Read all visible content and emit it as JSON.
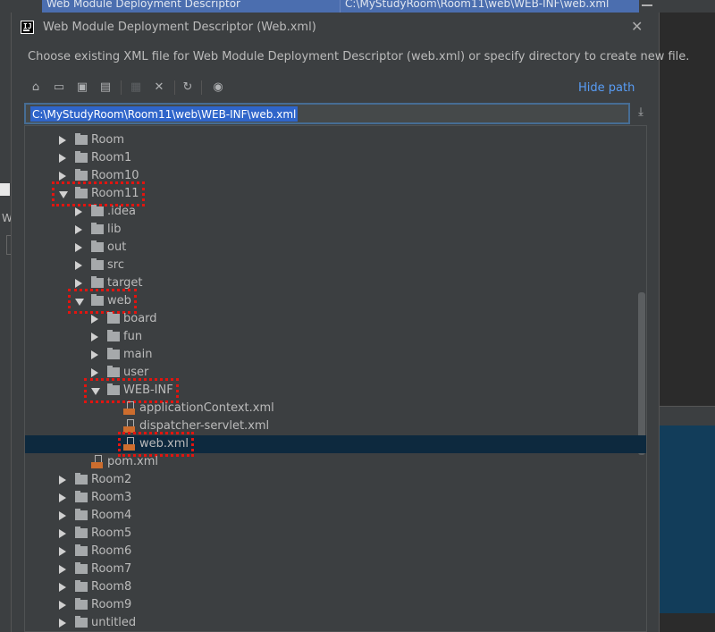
{
  "background": {
    "window_title": "Web Module Deployment Descriptor",
    "window_path": "C:\\MyStudyRoom\\Room11\\web\\WEB-INF\\web.xml",
    "left_letter": "W"
  },
  "dialog": {
    "title": "Web Module Deployment Descriptor (Web.xml)",
    "description": "Choose existing XML file for Web Module Deployment Descriptor (web.xml) or specify directory to create new file.",
    "hide_path_label": "Hide path",
    "path_value": "C:\\MyStudyRoom\\Room11\\web\\WEB-INF\\web.xml",
    "toolbar_icons": [
      "home-icon",
      "desktop-icon",
      "project-folder-icon",
      "module-folder-icon",
      "new-folder-icon",
      "delete-icon",
      "refresh-icon",
      "show-hidden-icon"
    ]
  },
  "tree": [
    {
      "label": "Room",
      "depth": 0,
      "type": "folder",
      "state": "collapsed"
    },
    {
      "label": "Room1",
      "depth": 0,
      "type": "folder",
      "state": "collapsed"
    },
    {
      "label": "Room10",
      "depth": 0,
      "type": "folder",
      "state": "collapsed"
    },
    {
      "label": "Room11",
      "depth": 0,
      "type": "folder",
      "state": "expanded",
      "highlight": true
    },
    {
      "label": ".idea",
      "depth": 1,
      "type": "folder",
      "state": "collapsed"
    },
    {
      "label": "lib",
      "depth": 1,
      "type": "folder",
      "state": "collapsed"
    },
    {
      "label": "out",
      "depth": 1,
      "type": "folder",
      "state": "collapsed"
    },
    {
      "label": "src",
      "depth": 1,
      "type": "folder",
      "state": "collapsed"
    },
    {
      "label": "target",
      "depth": 1,
      "type": "folder",
      "state": "collapsed"
    },
    {
      "label": "web",
      "depth": 1,
      "type": "folder",
      "state": "expanded",
      "highlight": true
    },
    {
      "label": "board",
      "depth": 2,
      "type": "folder",
      "state": "collapsed"
    },
    {
      "label": "fun",
      "depth": 2,
      "type": "folder",
      "state": "collapsed"
    },
    {
      "label": "main",
      "depth": 2,
      "type": "folder",
      "state": "collapsed"
    },
    {
      "label": "user",
      "depth": 2,
      "type": "folder",
      "state": "collapsed"
    },
    {
      "label": "WEB-INF",
      "depth": 2,
      "type": "folder",
      "state": "expanded",
      "highlight": true
    },
    {
      "label": "applicationContext.xml",
      "depth": 3,
      "type": "xml"
    },
    {
      "label": "dispatcher-servlet.xml",
      "depth": 3,
      "type": "xml"
    },
    {
      "label": "web.xml",
      "depth": 3,
      "type": "xml",
      "selected": true,
      "highlight": true
    },
    {
      "label": "pom.xml",
      "depth": 1,
      "type": "xml"
    },
    {
      "label": "Room2",
      "depth": 0,
      "type": "folder",
      "state": "collapsed"
    },
    {
      "label": "Room3",
      "depth": 0,
      "type": "folder",
      "state": "collapsed"
    },
    {
      "label": "Room4",
      "depth": 0,
      "type": "folder",
      "state": "collapsed"
    },
    {
      "label": "Room5",
      "depth": 0,
      "type": "folder",
      "state": "collapsed"
    },
    {
      "label": "Room6",
      "depth": 0,
      "type": "folder",
      "state": "collapsed"
    },
    {
      "label": "Room7",
      "depth": 0,
      "type": "folder",
      "state": "collapsed"
    },
    {
      "label": "Room8",
      "depth": 0,
      "type": "folder",
      "state": "collapsed"
    },
    {
      "label": "Room9",
      "depth": 0,
      "type": "folder",
      "state": "collapsed"
    },
    {
      "label": "untitled",
      "depth": 0,
      "type": "folder",
      "state": "collapsed"
    }
  ]
}
